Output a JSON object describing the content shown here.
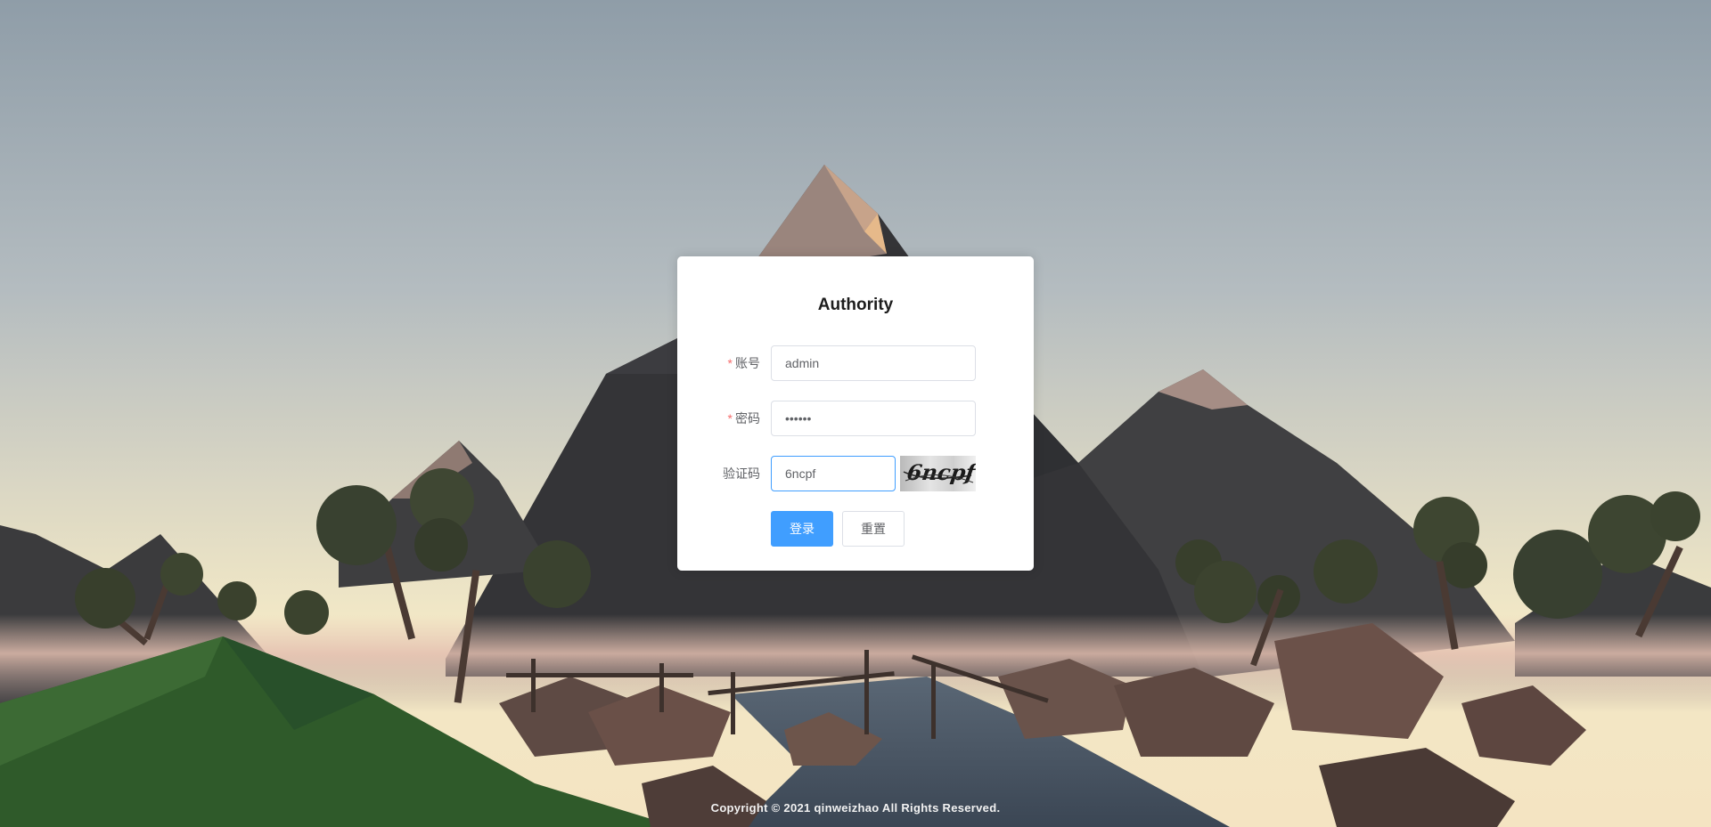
{
  "login": {
    "title": "Authority",
    "required_mark": "*",
    "account_label": "账号",
    "account_value": "admin",
    "password_label": "密码",
    "password_value": "••••••",
    "captcha_label": "验证码",
    "captcha_value": "6ncpf",
    "captcha_image_text": "6ncpf",
    "login_button": "登录",
    "reset_button": "重置"
  },
  "footer": {
    "copyright": "Copyright © 2021 qinweizhao All Rights Reserved."
  },
  "colors": {
    "primary": "#409eff",
    "required": "#f56c6c",
    "focused_border": "#409eff"
  }
}
